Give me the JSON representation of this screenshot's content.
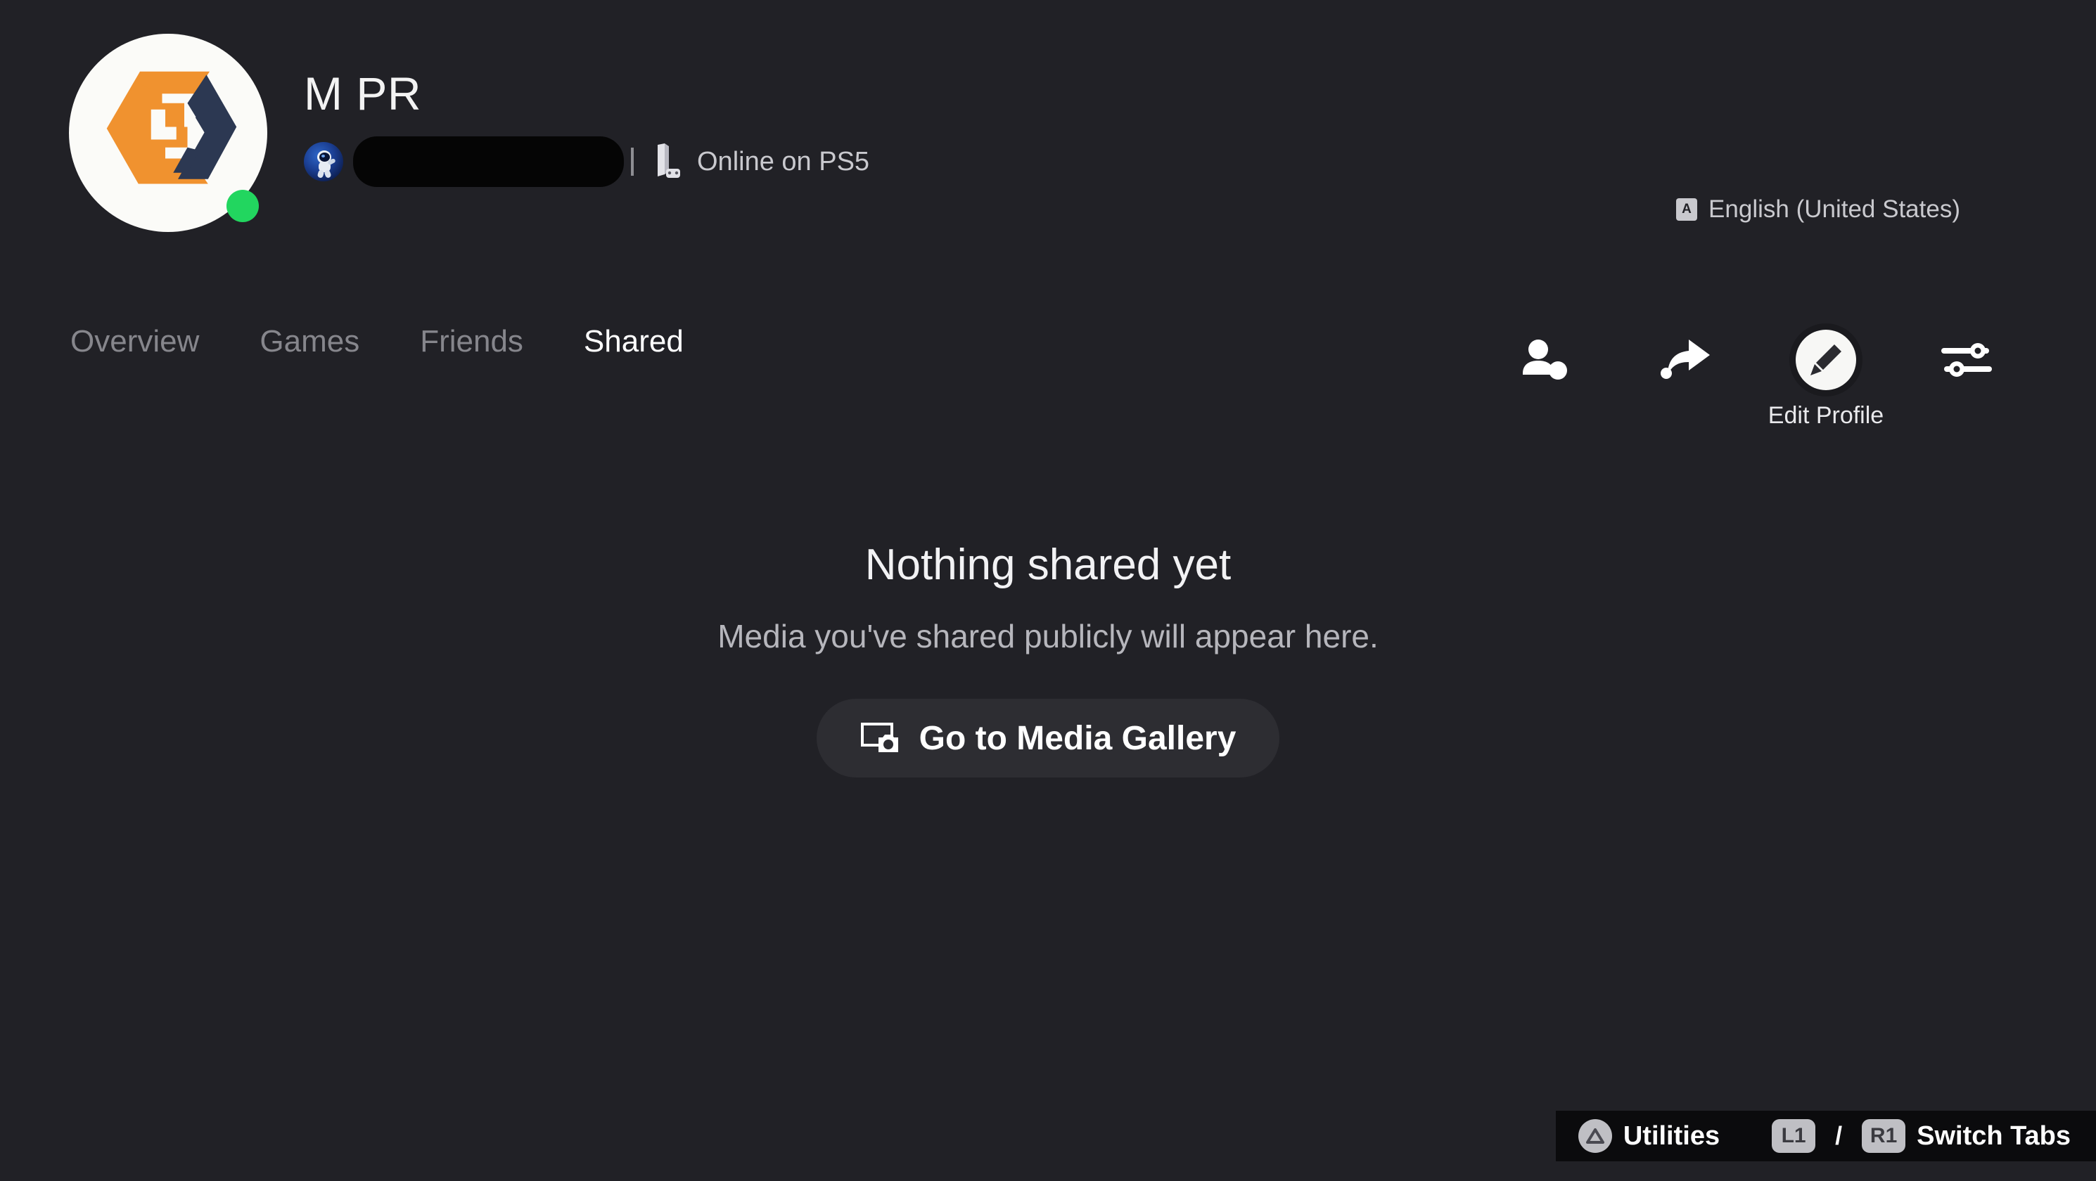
{
  "profile": {
    "display_name": "M PR",
    "online_id_redacted": true,
    "status_text": "Online on PS5",
    "status_icon": "ps5-console-icon",
    "presence": "online",
    "presence_color": "#22D65F",
    "avatar_icon": "tkg-logo-avatar",
    "avatar_colors": {
      "orange": "#F0922F",
      "navy": "#2C3852",
      "background": "#FBFBF8"
    },
    "small_avatar_icon": "astro-bot-icon",
    "separator": "|"
  },
  "language": {
    "icon": "language-icon",
    "icon_glyph": "A",
    "label": "English (United States)"
  },
  "tabs": [
    {
      "label": "Overview",
      "active": false
    },
    {
      "label": "Games",
      "active": false
    },
    {
      "label": "Friends",
      "active": false
    },
    {
      "label": "Shared",
      "active": true
    }
  ],
  "actions": [
    {
      "name": "add-friend",
      "icon": "add-friend-icon",
      "label": ""
    },
    {
      "name": "share",
      "icon": "share-arrow-icon",
      "label": ""
    },
    {
      "name": "edit-profile",
      "icon": "pencil-icon",
      "label": "Edit Profile",
      "focused": true
    },
    {
      "name": "profile-settings",
      "icon": "sliders-icon",
      "label": ""
    }
  ],
  "empty_state": {
    "title": "Nothing shared yet",
    "subtitle": "Media you've shared publicly will appear here.",
    "button_label": "Go to Media Gallery",
    "button_icon": "media-gallery-icon"
  },
  "bottom_bar": {
    "hints": [
      {
        "button_icon": "triangle-button-icon",
        "button_glyph": "△",
        "label": "Utilities"
      },
      {
        "keys": [
          "L1",
          "R1"
        ],
        "separator": "/",
        "label": "Switch Tabs"
      }
    ]
  },
  "theme": {
    "background": "#212126",
    "surface": "#2D2D32",
    "text_primary": "#F3F3F3",
    "text_secondary": "#C9C9CE",
    "text_muted": "#86868C",
    "accent_online": "#22D65F"
  }
}
